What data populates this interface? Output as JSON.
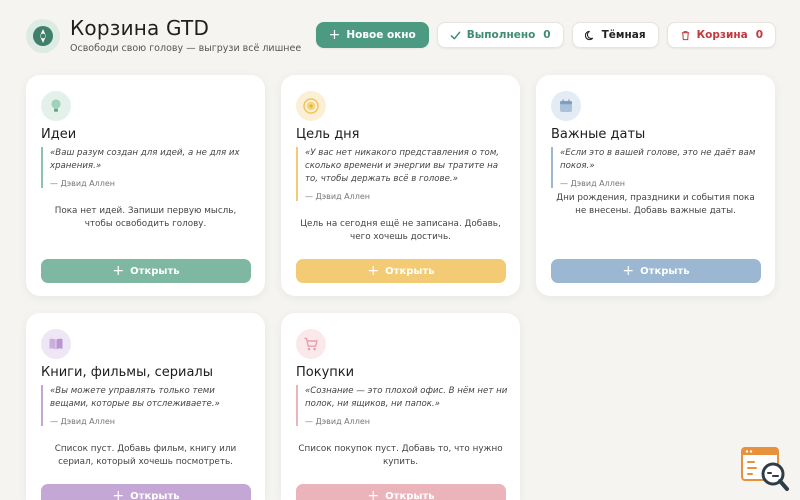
{
  "header": {
    "title": "Корзина GTD",
    "subtitle": "Освободи свою голову — выгрузи всё лишнее"
  },
  "toolbar": {
    "new_window": "Новое окно",
    "done_label": "Выполнено",
    "done_count": "0",
    "theme_label": "Тёмная",
    "trash_label": "Корзина",
    "trash_count": "0"
  },
  "colors": {
    "accent": "#4c9a82",
    "ideas": "#7fb8a2",
    "goal": "#f2cb74",
    "dates": "#9bb7d1",
    "books": "#c5a7d6",
    "shopping": "#ebb3ba"
  },
  "cards": [
    {
      "title": "Идеи",
      "icon": "lightbulb-icon",
      "quote": "«Ваш разум создан для идей, а не для их хранения.»",
      "author": "— Дэвид Аллен",
      "empty": "Пока нет идей. Запиши первую мысль, чтобы освободить голову.",
      "button": "Открыть"
    },
    {
      "title": "Цель дня",
      "icon": "target-icon",
      "quote": "«У вас нет никакого представления о том, сколько времени и энергии вы тратите на то, чтобы держать всё в голове.»",
      "author": "— Дэвид Аллен",
      "empty": "Цель на сегодня ещё не записана. Добавь, чего хочешь достичь.",
      "button": "Открыть"
    },
    {
      "title": "Важные даты",
      "icon": "calendar-icon",
      "quote": "«Если это в вашей голове, это не даёт вам покоя.»",
      "author": "— Дэвид Аллен",
      "empty": "Дни рождения, праздники и события пока не внесены. Добавь важные даты.",
      "button": "Открыть"
    },
    {
      "title": "Книги, фильмы, сериалы",
      "icon": "book-icon",
      "quote": "«Вы можете управлять только теми вещами, которые вы отслеживаете.»",
      "author": "— Дэвид Аллен",
      "empty": "Список пуст. Добавь фильм, книгу или сериал, который хочешь посмотреть.",
      "button": "Открыть"
    },
    {
      "title": "Покупки",
      "icon": "cart-icon",
      "quote": "«Сознание — это плохой офис. В нём нет ни полок, ни ящиков, ни папок.»",
      "author": "— Дэвид Аллен",
      "empty": "Список покупок пуст. Добавь то, что нужно купить.",
      "button": "Открыть"
    }
  ]
}
